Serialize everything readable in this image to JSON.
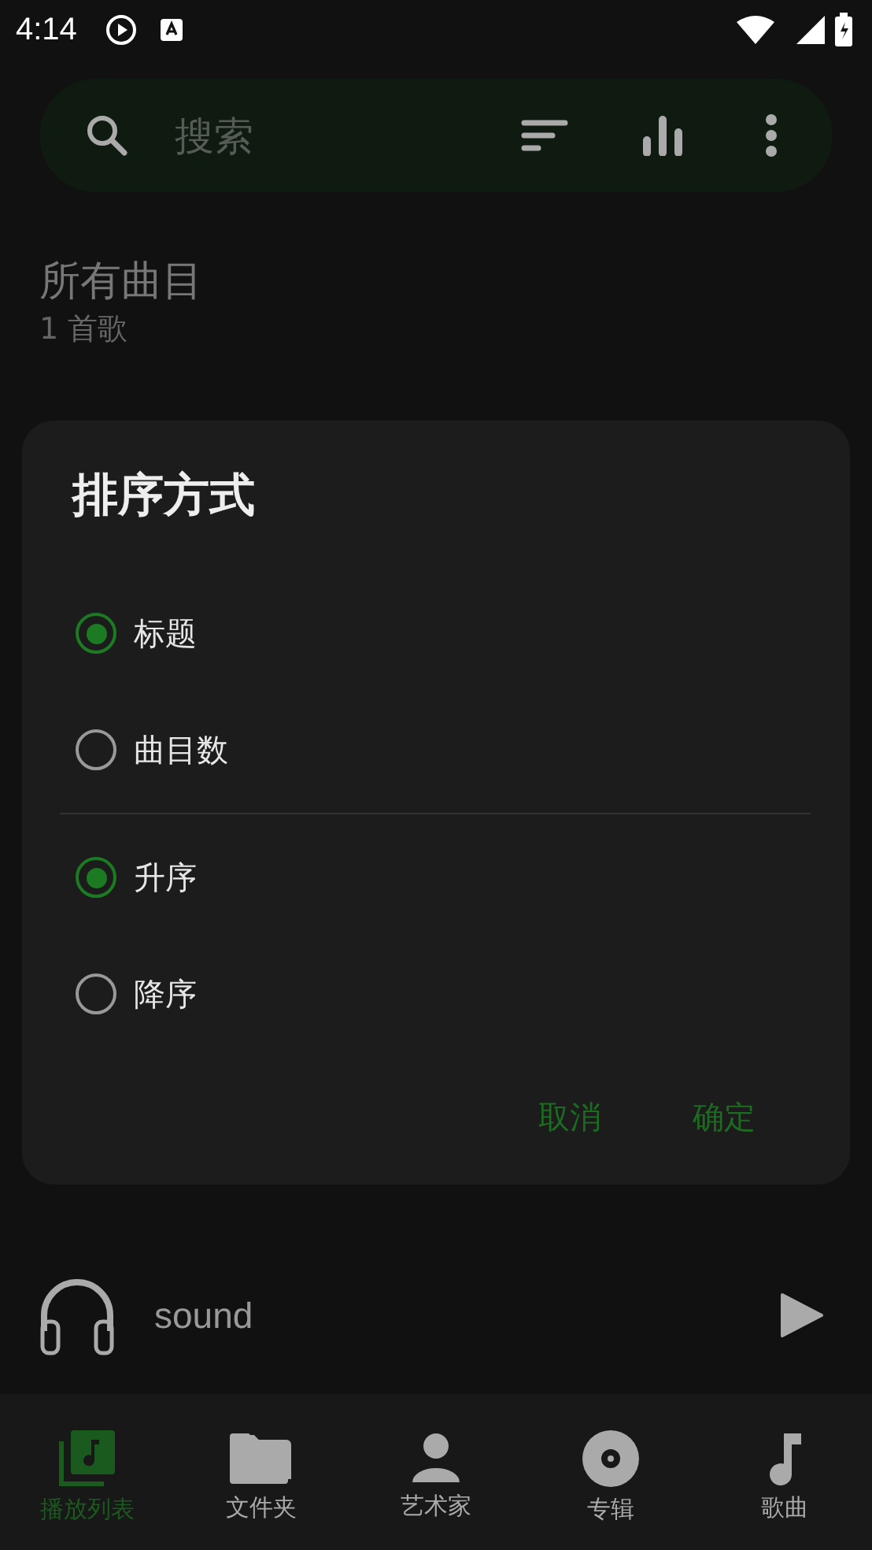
{
  "status_bar": {
    "time": "4:14"
  },
  "search": {
    "placeholder": "搜索"
  },
  "library": {
    "title": "所有曲目",
    "count": "1 首歌"
  },
  "dialog": {
    "title": "排序方式",
    "groups": [
      {
        "options": [
          {
            "label": "标题",
            "selected": true
          },
          {
            "label": "曲目数",
            "selected": false
          }
        ]
      },
      {
        "options": [
          {
            "label": "升序",
            "selected": true
          },
          {
            "label": "降序",
            "selected": false
          }
        ]
      }
    ],
    "buttons": [
      "取消",
      "确定"
    ]
  },
  "player": {
    "track": "sound"
  },
  "bottom_nav": [
    {
      "label": "播放列表",
      "selected": true
    },
    {
      "label": "文件夹",
      "selected": false
    },
    {
      "label": "艺术家",
      "selected": false
    },
    {
      "label": "专辑",
      "selected": false
    },
    {
      "label": "歌曲",
      "selected": false
    }
  ]
}
